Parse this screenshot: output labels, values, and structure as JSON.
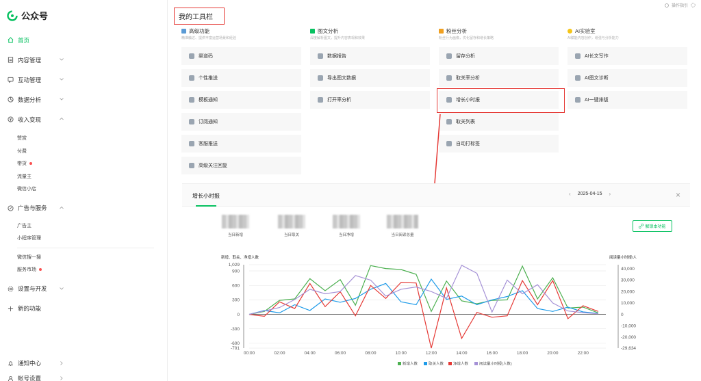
{
  "app": {
    "name": "公众号"
  },
  "topbar": {
    "help_label": "操作指引"
  },
  "sidebar": {
    "items": [
      {
        "key": "home",
        "label": "首页",
        "active": true,
        "icon": "home-icon"
      },
      {
        "key": "content",
        "label": "内容管理",
        "icon": "document-icon"
      },
      {
        "key": "interact",
        "label": "互动管理",
        "icon": "chat-icon"
      },
      {
        "key": "analytics",
        "label": "数据分析",
        "icon": "chart-icon"
      },
      {
        "key": "income",
        "label": "收入变现",
        "icon": "coin-icon",
        "expanded": true
      }
    ],
    "income_sub": [
      {
        "label": "赞赏"
      },
      {
        "label": "付费"
      },
      {
        "label": "带货",
        "dot": true
      },
      {
        "label": "流量主"
      },
      {
        "label": "微信小店"
      }
    ],
    "ads": {
      "label": "广告与服务",
      "icon": "compass-icon"
    },
    "ads_sub": [
      {
        "label": "广告主"
      },
      {
        "label": "小程序管理"
      }
    ],
    "ads_sub2": [
      {
        "label": "微信搜一搜"
      },
      {
        "label": "服务市场",
        "dot": true
      }
    ],
    "settings": {
      "label": "设置与开发",
      "icon": "gear-icon"
    },
    "new": {
      "label": "新的功能",
      "icon": "plus-icon"
    },
    "bottom": [
      {
        "label": "通知中心",
        "icon": "bell-icon"
      },
      {
        "label": "帐号设置",
        "icon": "user-icon"
      }
    ]
  },
  "main": {
    "title": "我的工具栏",
    "columns": [
      {
        "title": "高级功能",
        "desc": "精准触达、提供丰富运营场景和经验",
        "color": "#5b9bd5",
        "tools": [
          "渠道码",
          "个性推送",
          "模板通知",
          "订阅通知",
          "客服推送",
          "高级关注回复"
        ]
      },
      {
        "title": "图文分析",
        "desc": "深度解析图文，提升内容表现和效果",
        "color": "#07c160",
        "tools": [
          "数据报告",
          "导出图文数据",
          "打开率分析"
        ]
      },
      {
        "title": "粉丝分析",
        "desc": "粉丝行为画像，优化留存和增长策略",
        "color": "#f0a020",
        "tools": [
          "留存分析",
          "取关率分析",
          "增长小时报",
          "取关列表",
          "自动打标签"
        ]
      },
      {
        "title": "AI实验室",
        "desc": "AI赋能内容创作，增强与分析能力",
        "color": "#f5c518",
        "tools": [
          "AI长文写作",
          "AI图文诊断",
          "AI一键排版"
        ]
      }
    ]
  },
  "panel": {
    "title": "增长小时报",
    "date": "2025-04-15",
    "unlock_label": "解锁本功能",
    "stats": [
      {
        "label": "当日新增"
      },
      {
        "label": "当日取关"
      },
      {
        "label": "当日净增"
      },
      {
        "label": "当日阅读总量"
      }
    ]
  },
  "chart_data": {
    "type": "line",
    "ylabel_left": "新增、取关、净增人数",
    "ylabel_right": "阅读量小时报/人",
    "left_ticks": [
      "1,029",
      "900",
      "600",
      "300",
      "0",
      "-300",
      "-600",
      "-701"
    ],
    "right_ticks": [
      "40,000",
      "30,000",
      "20,000",
      "10,000",
      "0",
      "-10,000",
      "-20,000",
      "-29,634"
    ],
    "ylim_left": [
      -701,
      1029
    ],
    "ylim_right": [
      -29634,
      43500
    ],
    "x_labels": [
      "00:00",
      "02:00",
      "04:00",
      "06:00",
      "08:00",
      "10:00",
      "12:00",
      "14:00",
      "16:00",
      "18:00",
      "20:00",
      "22:00"
    ],
    "x": [
      0,
      1,
      2,
      3,
      4,
      5,
      6,
      7,
      8,
      9,
      10,
      11,
      12,
      13,
      14,
      15,
      16,
      17,
      18,
      19,
      20,
      21,
      22,
      23
    ],
    "series": [
      {
        "name": "新增人数",
        "axis": "left",
        "color": "#4cb050",
        "values": [
          0,
          60,
          290,
          320,
          740,
          490,
          720,
          190,
          1010,
          950,
          930,
          830,
          60,
          690,
          280,
          220,
          290,
          300,
          1000,
          320,
          760,
          130,
          150,
          30
        ]
      },
      {
        "name": "取关人数",
        "axis": "left",
        "color": "#1e9be9",
        "values": [
          0,
          80,
          30,
          200,
          80,
          320,
          250,
          330,
          520,
          640,
          260,
          200,
          730,
          310,
          380,
          200,
          300,
          370,
          490,
          120,
          60,
          150,
          50,
          20
        ]
      },
      {
        "name": "净增人数",
        "axis": "left",
        "color": "#e53935",
        "values": [
          0,
          -40,
          260,
          120,
          640,
          160,
          470,
          -30,
          600,
          330,
          660,
          650,
          -701,
          550,
          -500,
          40,
          -60,
          -30,
          700,
          200,
          700,
          -90,
          180,
          60
        ]
      },
      {
        "name": "阅读量小时报(人数)",
        "axis": "right",
        "color": "#a591d6",
        "values": [
          0,
          3000,
          6000,
          13000,
          22000,
          18000,
          20000,
          34000,
          30000,
          16000,
          22000,
          24000,
          20000,
          14000,
          43000,
          36000,
          2000,
          30000,
          18000,
          26000,
          10000,
          3000,
          1500,
          500
        ]
      }
    ],
    "grid": true,
    "legend": "bottom"
  }
}
